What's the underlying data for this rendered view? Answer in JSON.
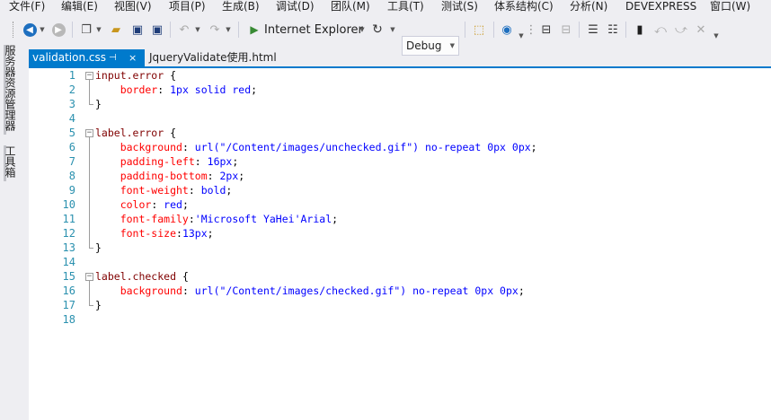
{
  "menu": [
    "文件(F)",
    "编辑(E)",
    "视图(V)",
    "项目(P)",
    "生成(B)",
    "调试(D)",
    "团队(M)",
    "工具(T)",
    "测试(S)",
    "体系结构(C)",
    "分析(N)",
    "DEVEXPRESS",
    "窗口(W)"
  ],
  "toolbar": {
    "browser_label": "Internet Explorer",
    "config_value": "Debug"
  },
  "side_tabs": [
    "服务器资源管理器",
    "工具箱"
  ],
  "tabs": {
    "active": "validation.css",
    "inactive": "JqueryValidate使用.html",
    "pin_glyph": "⊣",
    "close_glyph": "×"
  },
  "editor": {
    "lines": [
      {
        "n": "1",
        "fold": "−",
        "segs": [
          {
            "t": "input.error",
            "c": "sel"
          },
          {
            "t": " {",
            "c": "punc"
          }
        ]
      },
      {
        "n": "2",
        "segs": [
          {
            "t": "    border",
            "c": "prop"
          },
          {
            "t": ": ",
            "c": "punc"
          },
          {
            "t": "1px solid red",
            "c": "val"
          },
          {
            "t": ";",
            "c": "punc"
          }
        ]
      },
      {
        "n": "3",
        "segs": [
          {
            "t": "}",
            "c": "punc"
          }
        ]
      },
      {
        "n": "4",
        "segs": []
      },
      {
        "n": "5",
        "fold": "−",
        "segs": [
          {
            "t": "label.error",
            "c": "sel"
          },
          {
            "t": " {",
            "c": "punc"
          }
        ]
      },
      {
        "n": "6",
        "segs": [
          {
            "t": "    background",
            "c": "prop"
          },
          {
            "t": ": ",
            "c": "punc"
          },
          {
            "t": "url(\"/Content/images/unchecked.gif\") no-repeat 0px 0px",
            "c": "val"
          },
          {
            "t": ";",
            "c": "punc"
          }
        ]
      },
      {
        "n": "7",
        "segs": [
          {
            "t": "    padding-left",
            "c": "prop"
          },
          {
            "t": ": ",
            "c": "punc"
          },
          {
            "t": "16px",
            "c": "val"
          },
          {
            "t": ";",
            "c": "punc"
          }
        ]
      },
      {
        "n": "8",
        "segs": [
          {
            "t": "    padding-bottom",
            "c": "prop"
          },
          {
            "t": ": ",
            "c": "punc"
          },
          {
            "t": "2px",
            "c": "val"
          },
          {
            "t": ";",
            "c": "punc"
          }
        ]
      },
      {
        "n": "9",
        "segs": [
          {
            "t": "    font-weight",
            "c": "prop"
          },
          {
            "t": ": ",
            "c": "punc"
          },
          {
            "t": "bold",
            "c": "val"
          },
          {
            "t": ";",
            "c": "punc"
          }
        ]
      },
      {
        "n": "10",
        "segs": [
          {
            "t": "    color",
            "c": "prop"
          },
          {
            "t": ": ",
            "c": "punc"
          },
          {
            "t": "red",
            "c": "val"
          },
          {
            "t": ";",
            "c": "punc"
          }
        ]
      },
      {
        "n": "11",
        "segs": [
          {
            "t": "    font-family",
            "c": "prop"
          },
          {
            "t": ":",
            "c": "punc"
          },
          {
            "t": "'Microsoft YaHei'Arial",
            "c": "val"
          },
          {
            "t": ";",
            "c": "punc"
          }
        ]
      },
      {
        "n": "12",
        "segs": [
          {
            "t": "    font-size",
            "c": "prop"
          },
          {
            "t": ":",
            "c": "punc"
          },
          {
            "t": "13px",
            "c": "val"
          },
          {
            "t": ";",
            "c": "punc"
          }
        ]
      },
      {
        "n": "13",
        "segs": [
          {
            "t": "}",
            "c": "punc"
          }
        ]
      },
      {
        "n": "14",
        "segs": []
      },
      {
        "n": "15",
        "fold": "−",
        "segs": [
          {
            "t": "label.checked",
            "c": "sel"
          },
          {
            "t": " {",
            "c": "punc"
          }
        ]
      },
      {
        "n": "16",
        "segs": [
          {
            "t": "    background",
            "c": "prop"
          },
          {
            "t": ": ",
            "c": "punc"
          },
          {
            "t": "url(\"/Content/images/checked.gif\") no-repeat 0px 0px",
            "c": "val"
          },
          {
            "t": ";",
            "c": "punc"
          }
        ]
      },
      {
        "n": "17",
        "segs": [
          {
            "t": "}",
            "c": "punc"
          }
        ]
      },
      {
        "n": "18",
        "segs": []
      }
    ]
  },
  "colors": {
    "accent": "#007acc",
    "selector": "#800000",
    "property": "#ff0000",
    "value": "#0000ff",
    "line_number": "#2b91af"
  }
}
